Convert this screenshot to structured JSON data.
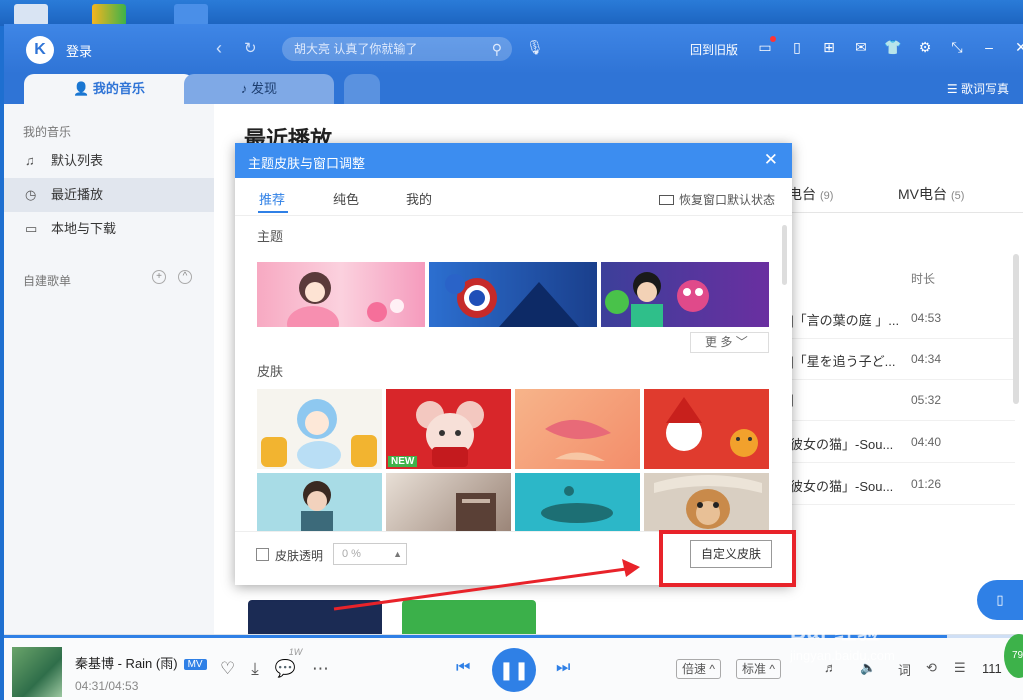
{
  "titlebar": {
    "logo": "K",
    "login": "登录",
    "search_placeholder": "胡大亮 认真了你就输了",
    "back_old": "回到旧版"
  },
  "tabs": {
    "my_music": "我的音乐",
    "discover": "发现",
    "lyrics": "歌词写真"
  },
  "sidebar": {
    "section_my": "我的音乐",
    "items": [
      {
        "label": "默认列表",
        "icon": "playlist-icon"
      },
      {
        "label": "最近播放",
        "icon": "clock-icon"
      },
      {
        "label": "本地与下载",
        "icon": "monitor-icon"
      }
    ],
    "section_custom": "自建歌单"
  },
  "main": {
    "title": "最近播放",
    "tab_radio": "电台",
    "tab_radio_count": "(9)",
    "tab_mv": "MV电台",
    "tab_mv_count": "(5)",
    "duration_header": "时长",
    "rows": [
      {
        "title": "]「言の葉の庭 」...",
        "duration": "04:53"
      },
      {
        "title": "]「星を追う子ど...",
        "duration": "04:34"
      },
      {
        "title": "]",
        "duration": "05:32"
      },
      {
        "title": "彼女の猫」-Sou...",
        "duration": "04:40"
      },
      {
        "title": "彼女の猫」-Sou...",
        "duration": "01:26"
      }
    ]
  },
  "player": {
    "song": "秦基博 - Rain (雨)",
    "mv_tag": "MV",
    "time": "04:31/04:53",
    "comment_count": "1W",
    "progress": 0.925,
    "speed": "倍速",
    "quality": "标准",
    "count": "111"
  },
  "modal": {
    "title": "主题皮肤与窗口调整",
    "tab_recommend": "推荐",
    "tab_solid": "纯色",
    "tab_mine": "我的",
    "restore": "恢复窗口默认状态",
    "section_theme": "主题",
    "more": "更 多",
    "section_skin": "皮肤",
    "new_badge": "NEW",
    "transparent_label": "皮肤透明",
    "transparent_value": "0 %",
    "custom_skin": "自定义皮肤"
  },
  "watermark": {
    "brand": "Bai 经验",
    "url": "jingyan.baidu.com"
  },
  "colors": {
    "brand_blue": "#2f80e6",
    "modal_header": "#3c8df0",
    "annotation_red": "#e8232a"
  }
}
